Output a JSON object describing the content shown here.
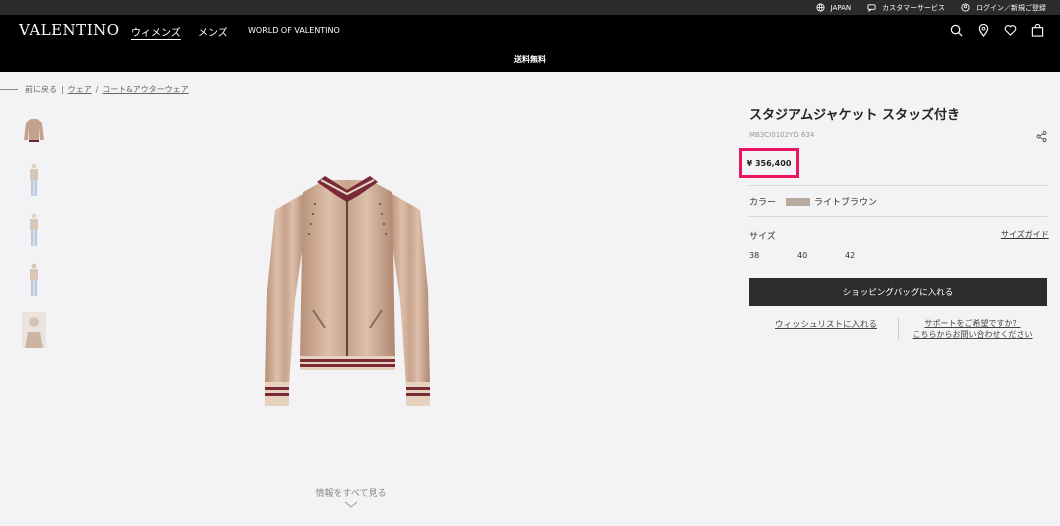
{
  "utility": {
    "country": "JAPAN",
    "customer_service": "カスタマーサービス",
    "login": "ログイン／新規ご登録"
  },
  "nav": {
    "logo": "VALENTINO",
    "women": "ウィメンズ",
    "men": "メンズ",
    "world": "WORLD OF VALENTINO"
  },
  "promo": "送料無料",
  "breadcrumb": {
    "back": "前に戻る",
    "sep": "|",
    "level1": "ウェア",
    "slash": "/",
    "level2": "コート&アウターウェア"
  },
  "product": {
    "title": "スタジアムジャケット スタッズ付き",
    "sku": "MB3CI0102YD 634",
    "price": "¥ 356,400",
    "color_label": "カラー",
    "color_name": "ライトブラウン",
    "color_hex": "#b8aba0",
    "size_label": "サイズ",
    "size_guide": "サイズガイド",
    "sizes": [
      "38",
      "40",
      "42"
    ],
    "add_to_bag": "ショッピングバッグに入れる",
    "wishlist": "ウィッシュリストに入れる",
    "support_line1": "サポートをご希望ですか？",
    "support_line2": "こちらからお問い合わせください"
  },
  "see_all": "情報をすべて見る",
  "colors": {
    "highlight": "#e8145f",
    "nav_bg": "#000000",
    "button_bg": "#2d2d2d"
  }
}
